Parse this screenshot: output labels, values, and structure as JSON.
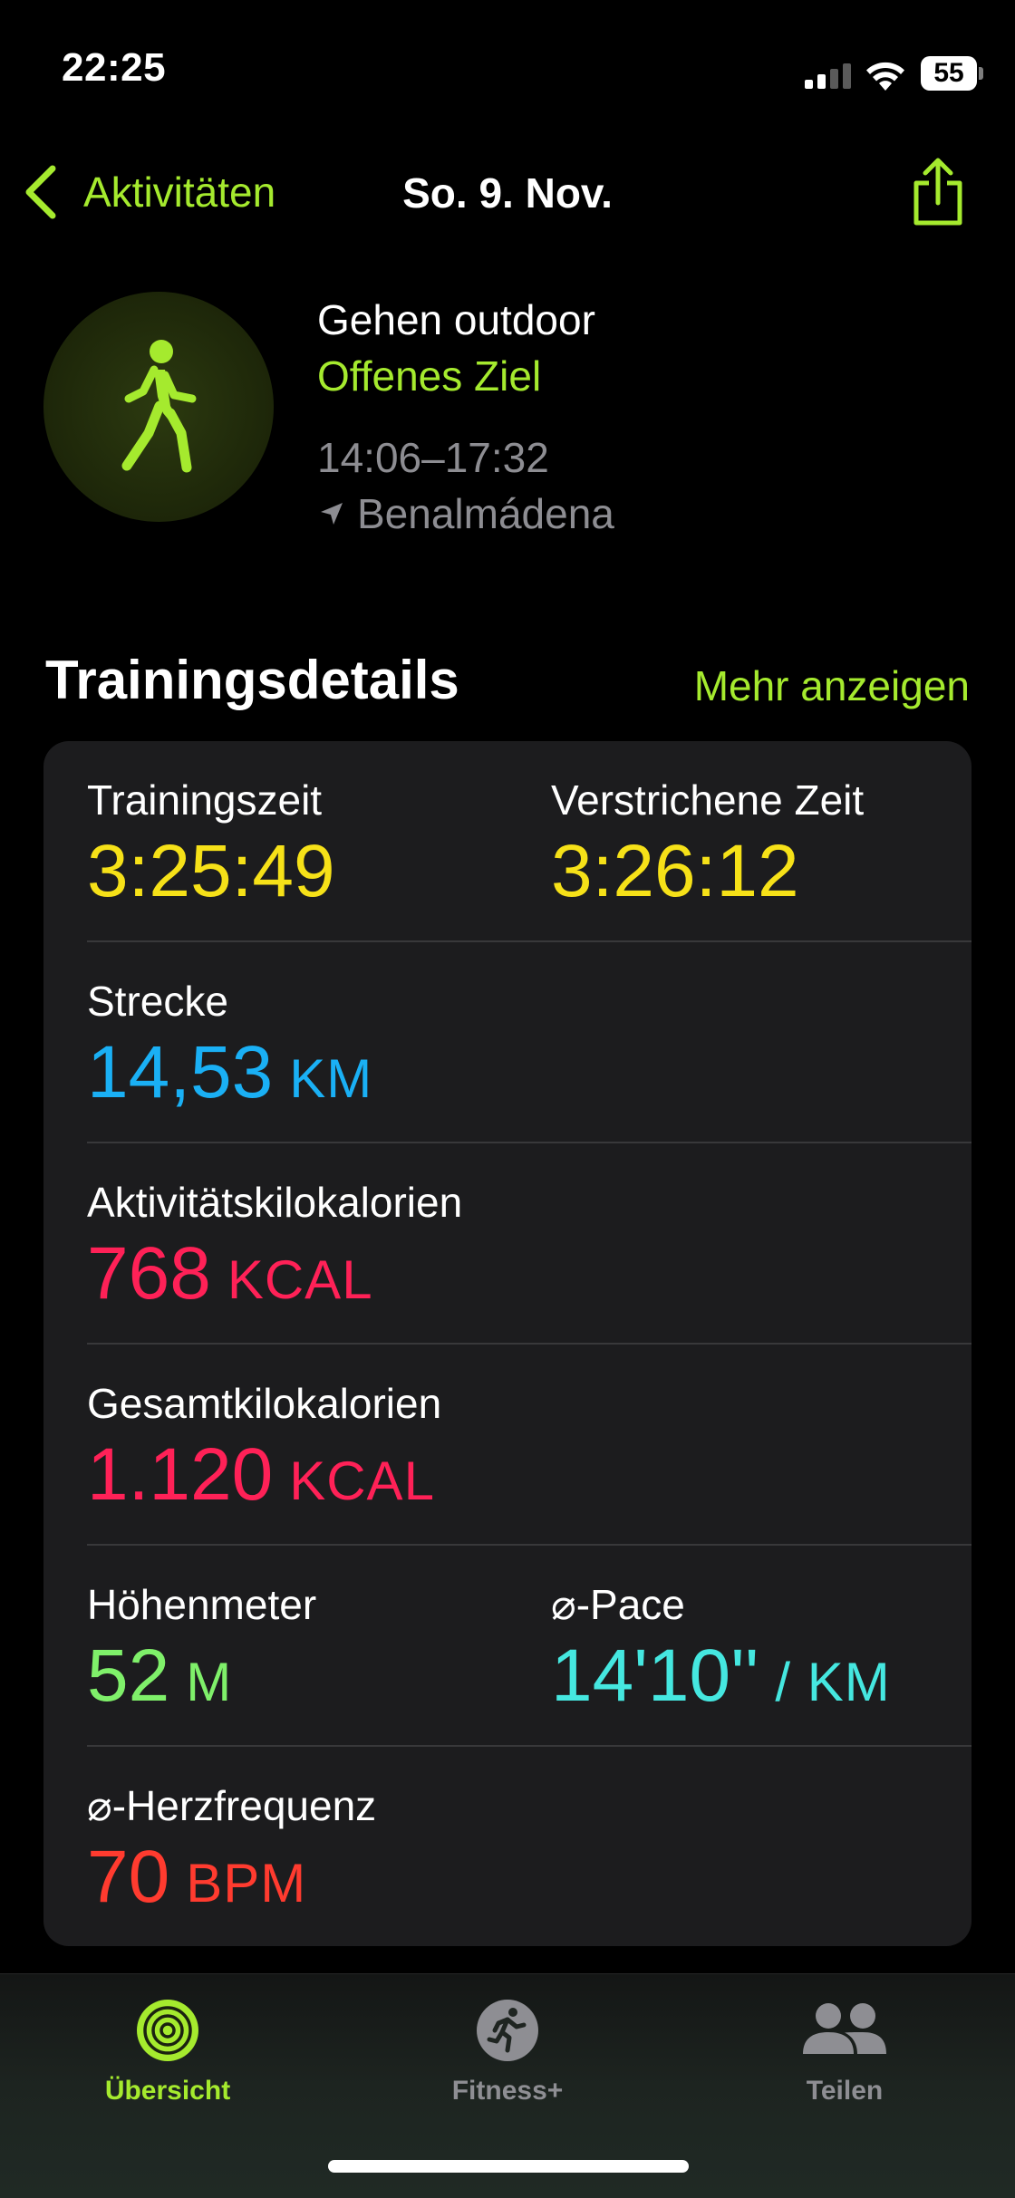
{
  "status_bar": {
    "time": "22:25",
    "battery_level": "55"
  },
  "nav": {
    "back_label": "Aktivitäten",
    "title": "So. 9. Nov."
  },
  "workout": {
    "type": "Gehen outdoor",
    "goal": "Offenes Ziel",
    "time_range": "14:06–17:32",
    "location": "Benalmádena",
    "icon": "figure-walk-icon"
  },
  "section": {
    "title": "Trainingsdetails",
    "show_more": "Mehr anzeigen"
  },
  "metrics": {
    "training_time": {
      "label": "Trainingszeit",
      "value": "3:25:49"
    },
    "elapsed_time": {
      "label": "Verstrichene Zeit",
      "value": "3:26:12"
    },
    "distance": {
      "label": "Strecke",
      "value": "14,53",
      "unit": "KM"
    },
    "active_kcal": {
      "label": "Aktivitätskilokalorien",
      "value": "768",
      "unit": "KCAL"
    },
    "total_kcal": {
      "label": "Gesamtkilokalorien",
      "value": "1.120",
      "unit": "KCAL"
    },
    "elevation": {
      "label": "Höhenmeter",
      "value": "52",
      "unit": "M"
    },
    "pace": {
      "label": "⌀-Pace",
      "value": "14'10''",
      "unit": "/ KM"
    },
    "heart_rate": {
      "label": "⌀-Herzfrequenz",
      "value": "70",
      "unit": "BPM"
    }
  },
  "tab_bar": {
    "tabs": [
      {
        "label": "Übersicht",
        "icon": "activity-rings-icon",
        "active": true
      },
      {
        "label": "Fitness+",
        "icon": "fitness-plus-icon",
        "active": false
      },
      {
        "label": "Teilen",
        "icon": "people-icon",
        "active": false
      }
    ]
  },
  "colors": {
    "accent": "#a5ea2e",
    "time": "#f6e118",
    "distance": "#1ab0f5",
    "calories": "#ff2157",
    "elevation": "#7ff06a",
    "pace": "#45e7e0",
    "heart_rate": "#ff3b2f",
    "inactive_tab": "#8e8e93"
  }
}
